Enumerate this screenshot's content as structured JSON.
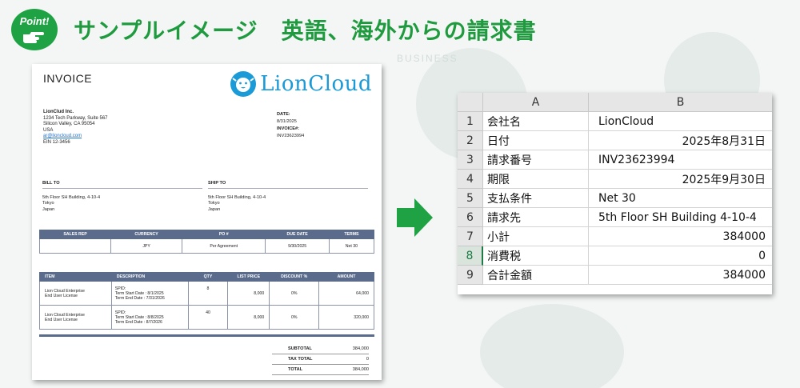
{
  "header": {
    "badge": "Point!",
    "title": "サンプルイメージ　英語、海外からの請求書"
  },
  "background": {
    "word": "BUSINESS"
  },
  "invoice": {
    "title": "INVOICE",
    "logo_text": "LionCloud",
    "company": {
      "name": "LionClud Inc.",
      "lines": [
        "1234 Tech Parkway, Suite 567",
        "Silicon Valley, CA 95054",
        "USA"
      ],
      "email": "ar@lioncloud.com",
      "ein": "EIN 12-3456"
    },
    "meta": {
      "date_label": "DATE:",
      "date": "8/31/2025",
      "invoice_label": "INVOICE#:",
      "invoice_no": "INV23623994"
    },
    "bill_to": {
      "label": "BILL TO",
      "lines": [
        "5th Floor SH Building, 4-10-4",
        "Tokyo",
        "Japan"
      ]
    },
    "ship_to": {
      "label": "SHIP TO",
      "lines": [
        "5th Floor SH Building, 4-10-4",
        "Tokyo",
        "Japan"
      ]
    },
    "summary": {
      "headers": [
        "SALES REP",
        "CURRENCY",
        "PO #",
        "DUE DATE",
        "TERMS"
      ],
      "values": [
        "",
        "JPY",
        "Per Agreement",
        "9/30/2025",
        "Net 30"
      ]
    },
    "lines": {
      "headers": [
        "ITEM",
        "DESCRIPTION",
        "QTY",
        "LIST PRICE",
        "DISCOUNT %",
        "AMOUNT"
      ],
      "rows": [
        {
          "item1": "Lion Cloud Enterprise",
          "item2": "End User License",
          "desc1": "SPID:",
          "desc2": "Term Start Date : 8/1/2025",
          "desc3": "Term End Date : 7/31/2026",
          "qty": "8",
          "price": "8,000",
          "discount": "0%",
          "amount": "64,000"
        },
        {
          "item1": "Lion Cloud Enterprise",
          "item2": "End User License",
          "desc1": "SPID:",
          "desc2": "Term Start Date : 8/8/2025",
          "desc3": "Term End Date : 8/7/2026",
          "qty": "40",
          "price": "8,000",
          "discount": "0%",
          "amount": "320,000"
        }
      ]
    },
    "totals": [
      {
        "label": "SUBTOTAL",
        "value": "384,000"
      },
      {
        "label": "TAX TOTAL",
        "value": "0"
      },
      {
        "label": "TOTAL",
        "value": "384,000"
      }
    ]
  },
  "sheet": {
    "columns": [
      "A",
      "B"
    ],
    "rows": [
      {
        "n": "1",
        "a": "会社名",
        "b": "LionCloud",
        "align": "txt"
      },
      {
        "n": "2",
        "a": "日付",
        "b": "2025年8月31日",
        "align": "num"
      },
      {
        "n": "3",
        "a": "請求番号",
        "b": "INV23623994",
        "align": "txt"
      },
      {
        "n": "4",
        "a": "期限",
        "b": "2025年9月30日",
        "align": "num"
      },
      {
        "n": "5",
        "a": "支払条件",
        "b": "Net 30",
        "align": "txt"
      },
      {
        "n": "6",
        "a": "請求先",
        "b": "5th Floor SH Building 4-10-4",
        "align": "txt"
      },
      {
        "n": "7",
        "a": "小計",
        "b": "384000",
        "align": "num"
      },
      {
        "n": "8",
        "a": "消費税",
        "b": "0",
        "align": "num",
        "active": true
      },
      {
        "n": "9",
        "a": "合計金額",
        "b": "384000",
        "align": "num"
      }
    ]
  },
  "colors": {
    "brand_green": "#1fa244",
    "headline_green": "#1f9a3f",
    "logo_blue": "#1a9ad6",
    "table_header": "#5b6b8c"
  }
}
